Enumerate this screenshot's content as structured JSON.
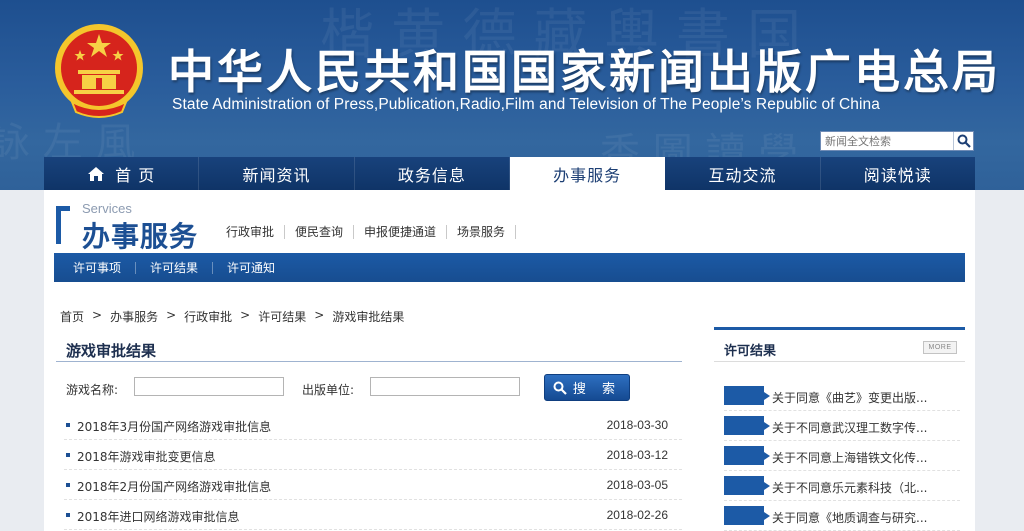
{
  "header": {
    "title": "中华人民共和国国家新闻出版广电总局",
    "subtitle": "State Administration of Press,Publication,Radio,Film and Television of The People’s Republic of China",
    "search_placeholder": "新闻全文检索",
    "colors": {
      "header_blue": "#2a5d9c",
      "nav_blue": "#0f3467",
      "accent_blue": "#1c5aa6"
    }
  },
  "nav": {
    "items": [
      {
        "label": "首 页",
        "icon": "home-icon"
      },
      {
        "label": "新闻资讯"
      },
      {
        "label": "政务信息"
      },
      {
        "label": "办事服务",
        "active": true
      },
      {
        "label": "互动交流"
      },
      {
        "label": "阅读悦读"
      }
    ]
  },
  "services": {
    "en_label": "Services",
    "cn_label": "办事服务",
    "sublinks": [
      "行政审批",
      "便民查询",
      "申报便捷通道",
      "场景服务"
    ],
    "bar_links": [
      "许可事项",
      "许可结果",
      "许可通知"
    ]
  },
  "breadcrumb": [
    "首页",
    ">",
    "办事服务",
    ">",
    "行政审批",
    ">",
    "许可结果",
    ">",
    "游戏审批结果"
  ],
  "main": {
    "title": "游戏审批结果",
    "filter": {
      "game_name_label": "游戏名称:",
      "publisher_label": "出版单位:",
      "search_button": "搜 索",
      "game_name_value": "",
      "publisher_value": ""
    },
    "list": [
      {
        "title": "2018年3月份国产网络游戏审批信息",
        "date": "2018-03-30"
      },
      {
        "title": "2018年游戏审批变更信息",
        "date": "2018-03-12"
      },
      {
        "title": "2018年2月份国产网络游戏审批信息",
        "date": "2018-03-05"
      },
      {
        "title": "2018年进口网络游戏审批信息",
        "date": "2018-02-26"
      }
    ]
  },
  "sidebar": {
    "heading": "许可结果",
    "more": "MORE",
    "items": [
      "关于同意《曲艺》变更出版...",
      "关于不同意武汉理工数字传...",
      "关于不同意上海错铁文化传...",
      "关于不同意乐元素科技（北...",
      "关于同意《地质调查与研究..."
    ]
  }
}
